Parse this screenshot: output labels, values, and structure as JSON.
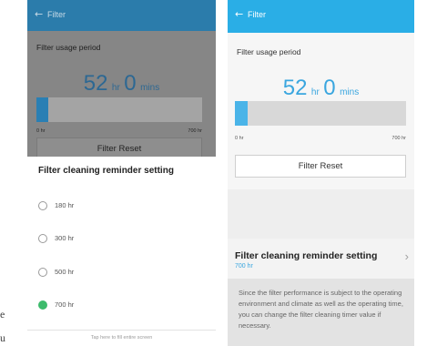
{
  "page_fragments": [
    "e",
    "u"
  ],
  "colors": {
    "accent_blue": "#2aaee6",
    "selected_green": "#3dbb6c",
    "dim_overlay": "#868686"
  },
  "left_phone": {
    "header": {
      "back_icon": "arrow-left-icon",
      "back_glyph": "←",
      "title": "Filter"
    },
    "usage": {
      "label": "Filter usage period",
      "hours": "52",
      "hours_unit": "hr",
      "minutes": "0",
      "minutes_unit": "mins",
      "progress_fraction": 0.074,
      "min_label": "0 hr",
      "max_label": "700 hr"
    },
    "reset_label": "Filter Reset",
    "dialog": {
      "title": "Filter cleaning reminder setting",
      "options": [
        {
          "label": "180 hr",
          "selected": false
        },
        {
          "label": "300 hr",
          "selected": false
        },
        {
          "label": "500 hr",
          "selected": false
        },
        {
          "label": "700 hr",
          "selected": true
        }
      ],
      "footer": "Tap here to fill entire screen"
    }
  },
  "right_phone": {
    "header": {
      "back_icon": "arrow-left-icon",
      "back_glyph": "←",
      "title": "Filter"
    },
    "usage": {
      "label": "Filter usage period",
      "hours": "52",
      "hours_unit": "hr",
      "minutes": "0",
      "minutes_unit": "mins",
      "progress_fraction": 0.074,
      "min_label": "0 hr",
      "max_label": "700 hr"
    },
    "reset_label": "Filter Reset",
    "reminder": {
      "title": "Filter cleaning reminder setting",
      "value": "700 hr",
      "chevron_icon": "chevron-right-icon",
      "chevron_glyph": "›"
    },
    "description": "Since the filter performance is subject to the operating environment and climate as well as the operating time, you can change the filter cleaning timer value if necessary."
  }
}
